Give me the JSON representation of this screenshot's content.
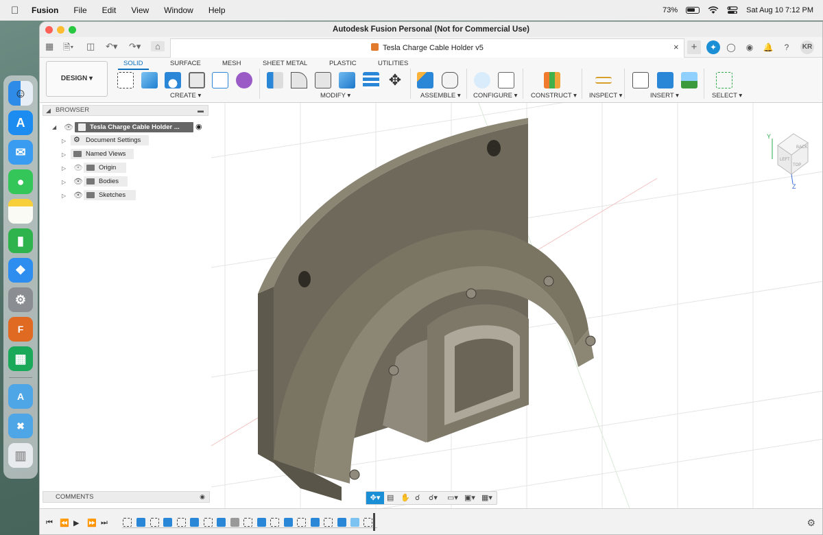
{
  "menubar": {
    "app_name": "Fusion",
    "items": [
      "File",
      "Edit",
      "View",
      "Window",
      "Help"
    ],
    "battery": "73%",
    "datetime": "Sat Aug 10  7:12 PM"
  },
  "window": {
    "title": "Autodesk Fusion Personal (Not for Commercial Use)"
  },
  "document_tab": {
    "title": "Tesla Charge Cable Holder v5",
    "close": "×",
    "add": "+",
    "user_initials": "KR"
  },
  "ribbon": {
    "workspace": "DESIGN ▾",
    "tabs": [
      "SOLID",
      "SURFACE",
      "MESH",
      "SHEET METAL",
      "PLASTIC",
      "UTILITIES"
    ],
    "active_tab": "SOLID",
    "groups": [
      "CREATE ▾",
      "MODIFY ▾",
      "ASSEMBLE ▾",
      "CONFIGURE ▾",
      "CONSTRUCT ▾",
      "INSPECT ▾",
      "INSERT ▾",
      "SELECT ▾"
    ]
  },
  "browser": {
    "header": "BROWSER",
    "root": "Tesla Charge Cable Holder ...",
    "items": [
      "Document Settings",
      "Named Views",
      "Origin",
      "Bodies",
      "Sketches"
    ]
  },
  "comments": {
    "label": "COMMENTS"
  },
  "viewcube": {
    "front": "LEFT",
    "top": "TOP",
    "side": "BACK",
    "y_axis": "Y",
    "z_axis": "Z"
  },
  "colors": {
    "accent": "#0a6ebd",
    "model": "#7b7565",
    "active_nav": "#1b8fd6"
  }
}
